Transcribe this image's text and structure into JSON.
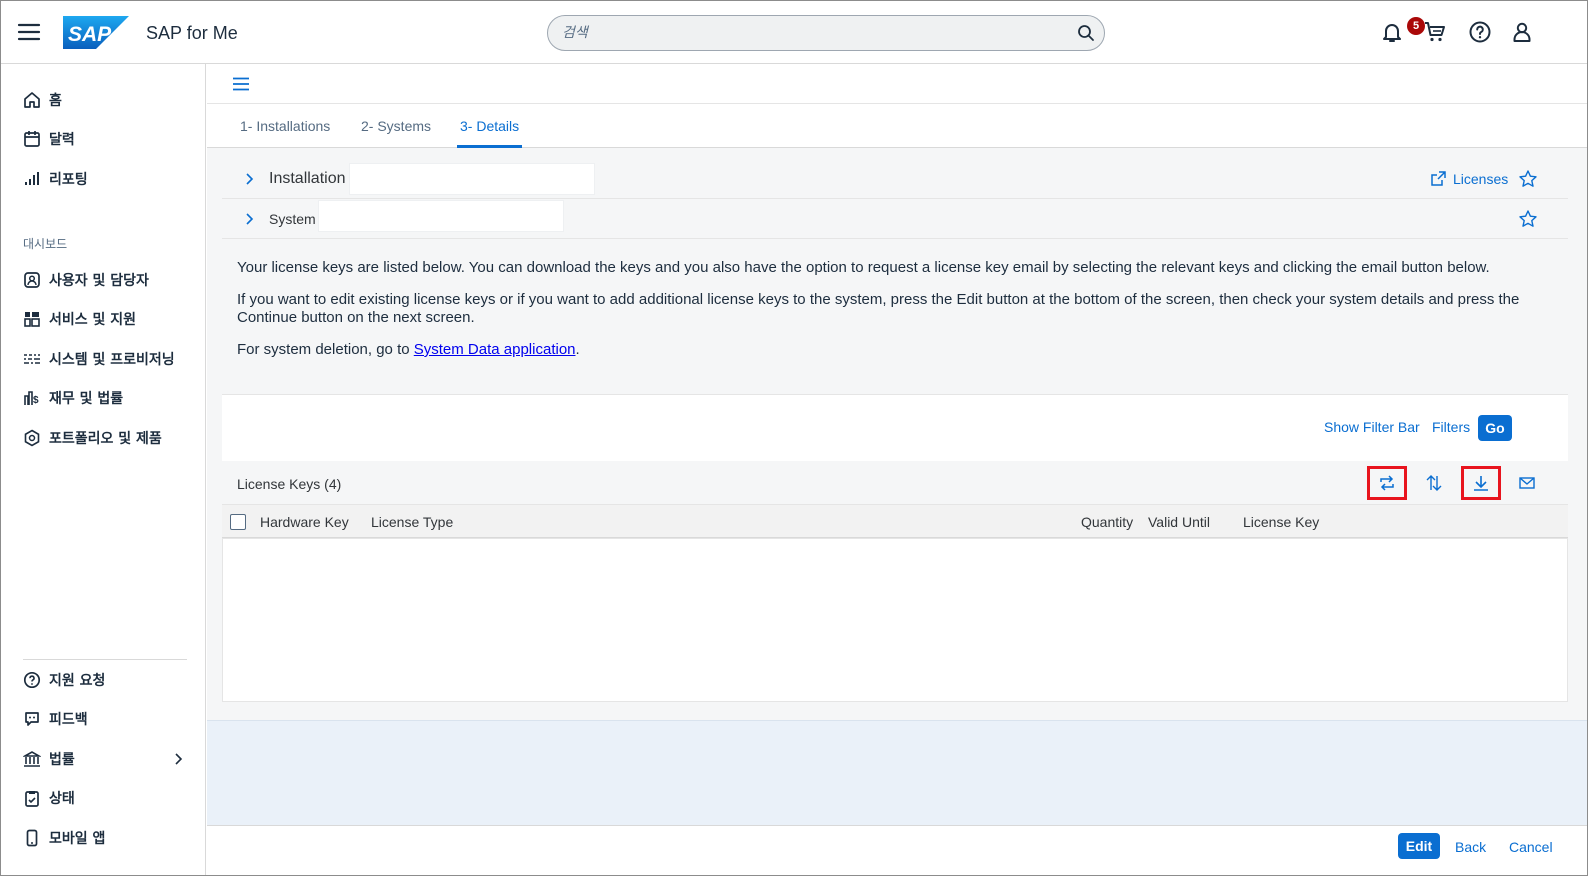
{
  "shell": {
    "app_title": "SAP for Me",
    "logo_text": "SAP",
    "search_placeholder": "검색",
    "notification_count": "5",
    "icons": [
      "menu-icon",
      "bell-icon",
      "cart-icon",
      "help-icon",
      "user-icon"
    ]
  },
  "sidenav": {
    "top_items": [
      {
        "label": "홈",
        "icon": "home-icon"
      },
      {
        "label": "달력",
        "icon": "calendar-icon"
      },
      {
        "label": "리포팅",
        "icon": "bar-chart-icon"
      }
    ],
    "section_label": "대시보드",
    "dashboard_items": [
      {
        "label": "사용자 및 담당자",
        "icon": "contacts-icon"
      },
      {
        "label": "서비스 및 지원",
        "icon": "services-icon"
      },
      {
        "label": "시스템 및 프로비저닝",
        "icon": "systems-icon"
      },
      {
        "label": "재무 및 법률",
        "icon": "finance-icon"
      },
      {
        "label": "포트폴리오 및 제품",
        "icon": "portfolio-icon"
      }
    ],
    "bottom_items": [
      {
        "label": "지원 요청",
        "icon": "support-icon"
      },
      {
        "label": "피드백",
        "icon": "feedback-icon"
      },
      {
        "label": "법률",
        "icon": "legal-icon"
      },
      {
        "label": "상태",
        "icon": "status-icon"
      },
      {
        "label": "모바일 앱",
        "icon": "mobile-icon"
      }
    ]
  },
  "tabs": [
    {
      "label": "1- Installations",
      "active": false
    },
    {
      "label": "2- Systems",
      "active": false
    },
    {
      "label": "3- Details",
      "active": true
    }
  ],
  "panels": {
    "installation_label": "Installation",
    "system_label": "System",
    "licenses_link": "Licenses"
  },
  "info": {
    "para1": "Your license keys are listed below. You can download the keys and you also have the option to request a license key email by selecting the relevant keys and clicking the email button below.",
    "para2": "If you want to edit existing license keys or if you want to add additional license keys to the system, press the Edit button at the bottom of the screen, then check your system details and press the Continue button on the next screen.",
    "para3_prefix": "For system deletion, go to ",
    "para3_link": "System Data application",
    "para3_suffix": "."
  },
  "filterbar": {
    "show_filter_bar": "Show Filter Bar",
    "filters": "Filters",
    "go": "Go"
  },
  "table": {
    "title": "License Keys (4)",
    "toolbar_icons": [
      "refresh-icon",
      "sort-icon",
      "download-icon",
      "email-icon"
    ],
    "columns": [
      "Hardware Key",
      "License Type",
      "Quantity",
      "Valid Until",
      "License Key"
    ],
    "rows": []
  },
  "footer": {
    "edit": "Edit",
    "back": "Back",
    "cancel": "Cancel"
  },
  "colors": {
    "accent": "#0a6ed1",
    "highlight": "#e8141e",
    "badge": "#aa0808"
  }
}
